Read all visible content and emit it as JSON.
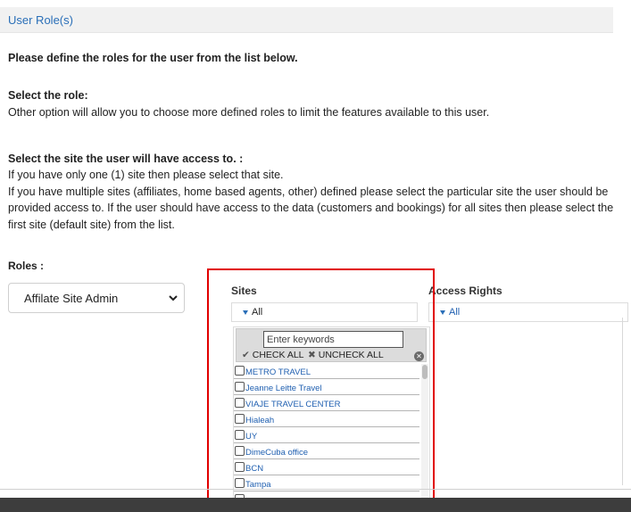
{
  "header": {
    "title": "User Role(s)"
  },
  "intro": {
    "text": "Please define the roles for the user from the list below."
  },
  "role_help": {
    "heading": "Select the role:",
    "text": "Other option will allow you to choose more defined roles to limit the features available to this user."
  },
  "site_help": {
    "heading": "Select the site the user will have access to. :",
    "line1": "If you have only one (1) site then please select that site.",
    "line2": "If you have multiple sites (affiliates, home based agents, other) defined please select the particular site the user should be",
    "line3": "provided access to. If the user should have access to the data (customers and bookings) for all sites then please select the",
    "line4": "first site (default site) from the list."
  },
  "roles": {
    "label": "Roles :",
    "selected": "Affilate Site Admin"
  },
  "sites": {
    "label": "Sites",
    "selected": "All",
    "search_placeholder": "Enter keywords",
    "check_all": "CHECK ALL",
    "uncheck_all": "UNCHECK ALL",
    "items": [
      "METRO TRAVEL",
      "Jeanne Leitte Travel",
      "VIAJE TRAVEL CENTER",
      "Hialeah",
      "UY",
      "DimeCuba office",
      "BCN",
      "Tampa"
    ]
  },
  "access_rights": {
    "label": "Access Rights",
    "selected": "All"
  },
  "colors": {
    "link": "#1f5fb0",
    "highlight": "#e10000",
    "header_bg": "#f1f1f1"
  }
}
